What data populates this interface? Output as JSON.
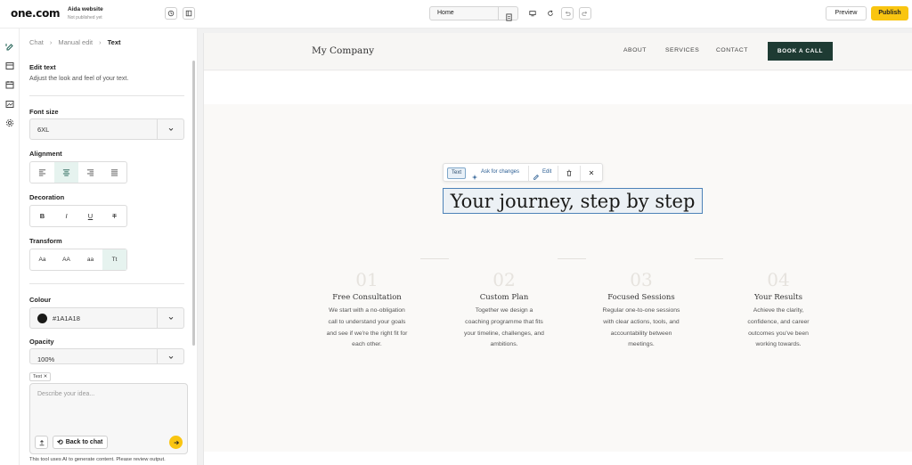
{
  "topbar": {
    "logo": "one.com",
    "site_name": "Aida website",
    "site_status": "Not published yet",
    "page_select": "Home",
    "preview_label": "Preview",
    "publish_label": "Publish"
  },
  "panel": {
    "breadcrumb": [
      "Chat",
      "Manual edit",
      "Text"
    ],
    "edit_title": "Edit text",
    "edit_subtitle": "Adjust the look and feel of your text.",
    "font_size": {
      "label": "Font size",
      "value": "6XL"
    },
    "alignment": {
      "label": "Alignment",
      "options": [
        "left",
        "center",
        "right",
        "justify"
      ],
      "selected": "center"
    },
    "decoration": {
      "label": "Decoration",
      "options": [
        "B",
        "I",
        "U",
        "T"
      ]
    },
    "transform": {
      "label": "Transform",
      "options": [
        "Aa",
        "AA",
        "aa",
        "Tt"
      ],
      "selected": "Tt"
    },
    "colour": {
      "label": "Colour",
      "value": "#1A1A18",
      "swatch": "#1a1a18"
    },
    "opacity": {
      "label": "Opacity",
      "value": "100%"
    },
    "chip": "Text",
    "chat_placeholder": "Describe your idea...",
    "back_to_chat": "Back to chat",
    "disclaimer": "This tool uses AI to generate content. Please review output."
  },
  "site": {
    "brand": "My Company",
    "nav": [
      "ABOUT",
      "SERVICES",
      "CONTACT"
    ],
    "cta": "BOOK A CALL",
    "headline": "Your journey, step by step",
    "toolbar": {
      "text": "Text",
      "ask": "Ask for changes",
      "edit": "Edit"
    },
    "steps": [
      {
        "num": "01",
        "title": "Free Consultation",
        "desc": "We start with a no-obligation call to understand your goals and see if we're the right fit for each other."
      },
      {
        "num": "02",
        "title": "Custom Plan",
        "desc": "Together we design a coaching programme that fits your timeline, challenges, and ambitions."
      },
      {
        "num": "03",
        "title": "Focused Sessions",
        "desc": "Regular one-to-one sessions with clear actions, tools, and accountability between meetings."
      },
      {
        "num": "04",
        "title": "Your Results",
        "desc": "Achieve the clarity, confidence, and career outcomes you've been working towards."
      }
    ]
  },
  "colors": {
    "accent": "#f9c511",
    "cta_bg": "#1e3b33",
    "selection": "#4d82b8",
    "active_tab": "#e6f3ef"
  }
}
